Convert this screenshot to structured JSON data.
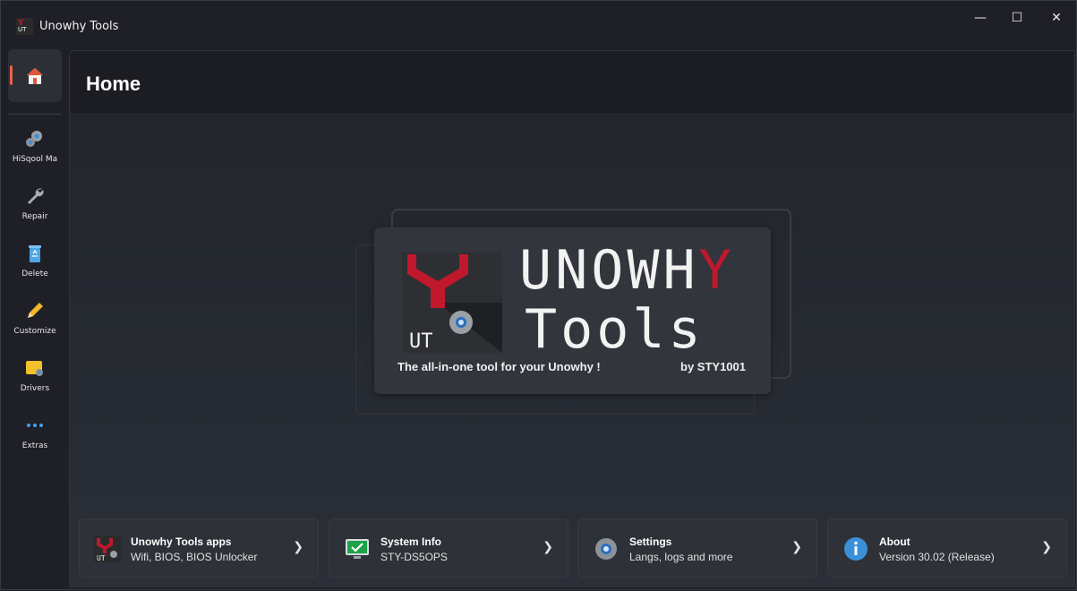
{
  "window": {
    "title": "Unowhy Tools"
  },
  "controls": {
    "minimize": "—",
    "maximize": "☐",
    "close": "✕"
  },
  "nav": {
    "items": [
      {
        "label": "HiSqool Ma",
        "icon": "gears-icon"
      },
      {
        "label": "Repair",
        "icon": "wrench-icon"
      },
      {
        "label": "Delete",
        "icon": "recycle-bin-icon"
      },
      {
        "label": "Customize",
        "icon": "pencil-icon"
      },
      {
        "label": "Drivers",
        "icon": "driver-icon"
      },
      {
        "label": "Extras",
        "icon": "more-dots-icon"
      }
    ]
  },
  "page": {
    "title": "Home"
  },
  "hero": {
    "brand_line1_main": "UNOWH",
    "brand_line1_accent": "Y",
    "brand_line2": "Tools",
    "logo_text": "UT",
    "tagline": "The all-in-one tool for your Unowhy !",
    "byline": "by STY1001"
  },
  "cards": [
    {
      "title": "Unowhy Tools apps",
      "subtitle": "Wifi, BIOS, BIOS Unlocker",
      "icon": "unowhy-logo-icon"
    },
    {
      "title": "System Info",
      "subtitle": "STY-DS5OPS",
      "icon": "monitor-check-icon"
    },
    {
      "title": "Settings",
      "subtitle": "Langs, logs and more",
      "icon": "gear-icon"
    },
    {
      "title": "About",
      "subtitle": "Version 30.02 (Release)",
      "icon": "info-icon"
    }
  ],
  "colors": {
    "accent": "#c0182c",
    "home_indicator": "#e8624a",
    "info_blue": "#3a8fd6"
  }
}
